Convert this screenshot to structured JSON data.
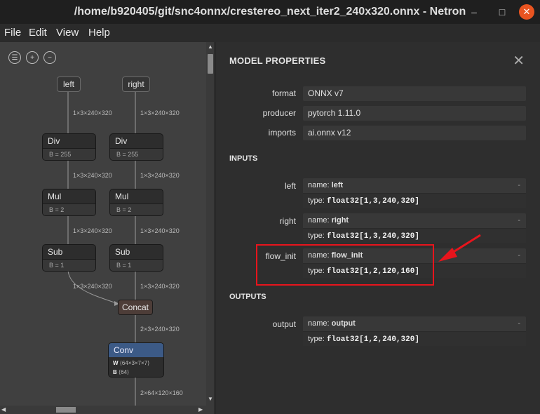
{
  "window": {
    "title": "/home/b920405/git/snc4onnx/crestereo_next_iter2_240x320.onnx - Netron",
    "controls": {
      "minimize": "–",
      "maximize": "□",
      "close": "✕"
    }
  },
  "menu": {
    "items": [
      "File",
      "Edit",
      "View",
      "Help"
    ]
  },
  "graph": {
    "toolbar": {
      "menu_icon": "☰",
      "zoom_in_icon": "+",
      "zoom_out_icon": "−"
    },
    "inputs": [
      {
        "label": "left"
      },
      {
        "label": "right"
      }
    ],
    "nodes": [
      {
        "op": "Div",
        "attr": "B = 255"
      },
      {
        "op": "Div",
        "attr": "B = 255"
      },
      {
        "op": "Mul",
        "attr": "B = 2"
      },
      {
        "op": "Mul",
        "attr": "B = 2"
      },
      {
        "op": "Sub",
        "attr": "B = 1"
      },
      {
        "op": "Sub",
        "attr": "B = 1"
      }
    ],
    "edge_labels": [
      "1×3×240×320",
      "1×3×240×320",
      "1×3×240×320",
      "1×3×240×320",
      "1×3×240×320",
      "1×3×240×320",
      "1×3×240×320",
      "1×3×240×320",
      "2×3×240×320",
      "2×64×120×160"
    ],
    "concat": {
      "label": "Concat"
    },
    "conv": {
      "label": "Conv",
      "weights": [
        {
          "key": "W",
          "shape": "⟨64×3×7×7⟩"
        },
        {
          "key": "B",
          "shape": "⟨64⟩"
        }
      ]
    },
    "scroll": {
      "up": "▲",
      "down": "▼",
      "left": "◀",
      "right": "▶"
    }
  },
  "panel": {
    "title": "MODEL PROPERTIES",
    "close_icon": "✕",
    "properties": [
      {
        "label": "format",
        "value": "ONNX v7"
      },
      {
        "label": "producer",
        "value": "pytorch 1.11.0"
      },
      {
        "label": "imports",
        "value": "ai.onnx v12"
      }
    ],
    "inputs_heading": "INPUTS",
    "inputs": [
      {
        "label": "left",
        "name": "left",
        "type": "float32[1,3,240,320]"
      },
      {
        "label": "right",
        "name": "right",
        "type": "float32[1,3,240,320]"
      },
      {
        "label": "flow_init",
        "name": "flow_init",
        "type": "float32[1,2,120,160]"
      }
    ],
    "outputs_heading": "OUTPUTS",
    "outputs": [
      {
        "label": "output",
        "name": "output",
        "type": "float32[1,2,240,320]"
      }
    ],
    "name_prefix": "name: ",
    "type_prefix": "type: ",
    "dash": "-"
  },
  "annotation": {
    "color": "#e8141c"
  }
}
